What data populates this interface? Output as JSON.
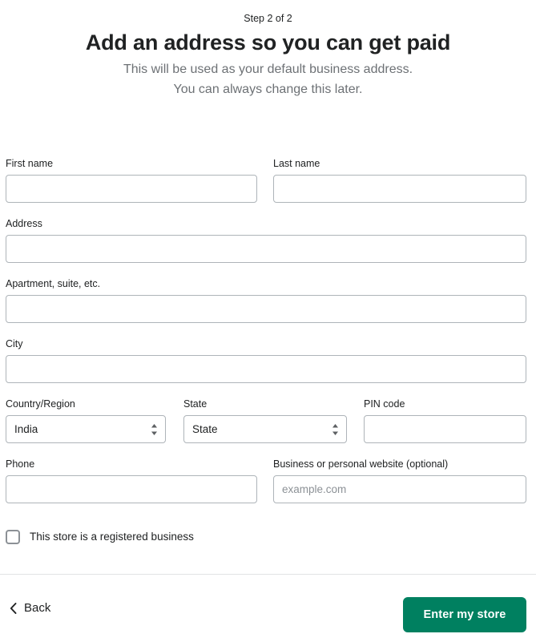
{
  "header": {
    "step_label": "Step 2 of 2",
    "title": "Add an address so you can get paid",
    "subtitle_line1": "This will be used as your default business address.",
    "subtitle_line2": "You can always change this later."
  },
  "form": {
    "first_name": {
      "label": "First name",
      "value": "",
      "placeholder": ""
    },
    "last_name": {
      "label": "Last name",
      "value": "",
      "placeholder": ""
    },
    "address": {
      "label": "Address",
      "value": "",
      "placeholder": ""
    },
    "apartment": {
      "label": "Apartment, suite, etc.",
      "value": "",
      "placeholder": ""
    },
    "city": {
      "label": "City",
      "value": "",
      "placeholder": ""
    },
    "country": {
      "label": "Country/Region",
      "value": "India",
      "options": [
        "India"
      ]
    },
    "state": {
      "label": "State",
      "value": "State",
      "options": [
        "State"
      ]
    },
    "pin_code": {
      "label": "PIN code",
      "value": "",
      "placeholder": ""
    },
    "phone": {
      "label": "Phone",
      "value": "",
      "placeholder": ""
    },
    "website": {
      "label": "Business or personal website (optional)",
      "value": "",
      "placeholder": "example.com"
    },
    "registered_business": {
      "label": "This store is a registered business",
      "checked": false
    }
  },
  "footer": {
    "back_label": "Back",
    "submit_label": "Enter my store"
  },
  "colors": {
    "primary_green": "#008060",
    "text": "#202223",
    "muted_text": "#6d7175",
    "placeholder": "#8c9196",
    "border": "#aeb4b9",
    "divider": "#e1e3e5"
  }
}
